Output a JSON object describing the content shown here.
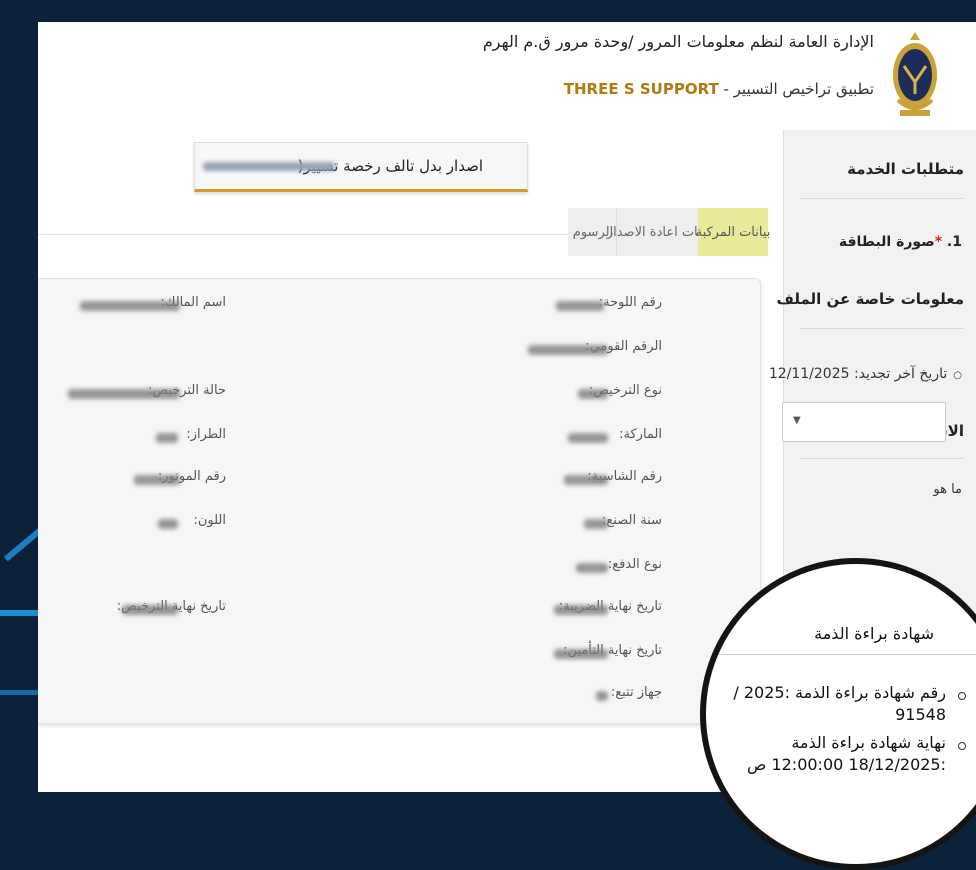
{
  "header": {
    "title": "الإدارة العامة لنظم معلومات المرور /وحدة مرور ق.م الهرم",
    "subtitle": "تطبيق تراخيص التسيير -",
    "brand": "THREE S SUPPORT"
  },
  "service": {
    "title": "اصدار بدل تالف رخصة تسيير("
  },
  "tabs": [
    {
      "label": "بيانات المركبة",
      "active": true
    },
    {
      "label": "بيانات اعادة الاصدار",
      "active": false
    },
    {
      "label": "الرسوم",
      "active": false
    }
  ],
  "vehicle": {
    "right_column": [
      "رقم اللوحة:",
      "الرقم القومي:",
      "نوع الترخيص:",
      "الماركة:",
      "رقم الشاسية:",
      "سنة الصنع:",
      "نوع الدفع:",
      "تاريخ نهاية الضريبة:",
      "تاريخ نهاية التأمين:",
      "جهاز تتبع:"
    ],
    "left_column": [
      "اسم المالك:",
      "حالة الترخيص:",
      "الطراز:",
      "رقم الموتور:",
      "اللون:",
      "تاريخ نهاية الترخيص:"
    ]
  },
  "sidebar": {
    "requirements_title": "متطلبات الخدمة",
    "item1_number": "1.",
    "item1_required": "*",
    "item1_label": "صورة البطاقة",
    "file_info_title": "معلومات خاصة عن الملف",
    "renewal_text": "تاريخ آخر تجديد: 12/11/2025",
    "faq_title": "الاسئلة السريعة",
    "faq_question": "ما هو",
    "select_arrow": "▼"
  },
  "certificate": {
    "title": "شهادة براءة الذمة",
    "number_label": "رقم شهادة براءة الذمة :2025 /",
    "number_value": "91548",
    "end_label": "نهاية شهادة براءة الذمة",
    "end_value": ":18/12/2025 12:00:00 ص"
  },
  "colors": {
    "brand": "#b07a10",
    "active_tab": "#e9e99a",
    "accent_underline": "#d69a30",
    "required": "#dd2211"
  }
}
